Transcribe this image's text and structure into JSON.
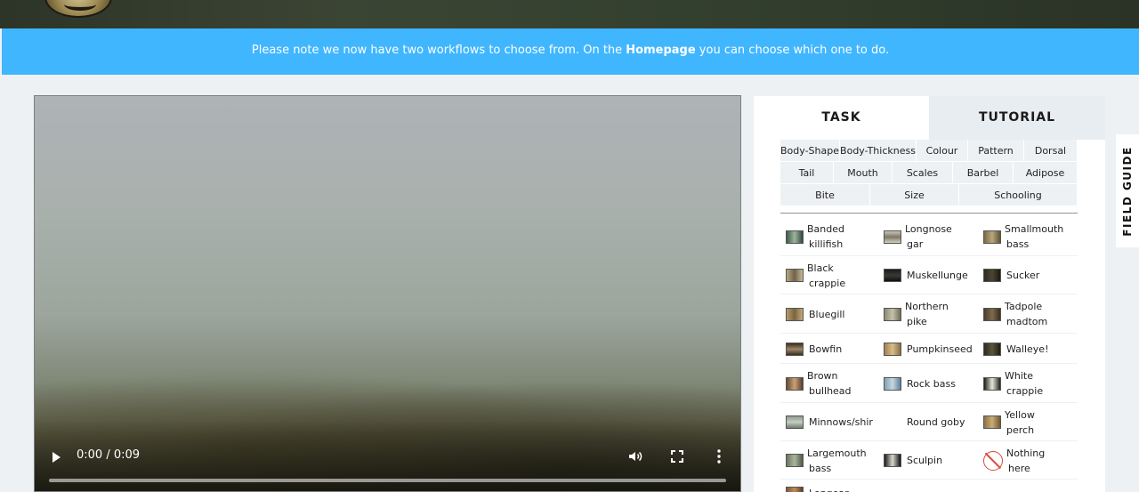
{
  "notice": {
    "prefix": "Please note we now have two workflows to choose from. On the ",
    "link": "Homepage",
    "suffix": " you can choose which one to do."
  },
  "video": {
    "time": "0:00 / 0:09",
    "progress": 0
  },
  "tabs": {
    "task": "TASK",
    "tutorial": "TUTORIAL"
  },
  "filters": [
    [
      "Body-Shape",
      "Body-Thickness",
      "Colour",
      "Pattern",
      "Dorsal"
    ],
    [
      "Tail",
      "Mouth",
      "Scales",
      "Barbel",
      "Adipose"
    ],
    [
      "Bite",
      "Size",
      "Schooling"
    ]
  ],
  "fish": [
    [
      "Banded",
      "killifish"
    ],
    [
      "Longnose",
      "gar"
    ],
    [
      "Smallmouth",
      "bass"
    ],
    [
      "Black",
      "crappie"
    ],
    [
      "Muskellunge"
    ],
    [
      "Sucker"
    ],
    [
      "Bluegill"
    ],
    [
      "Northern",
      "pike"
    ],
    [
      "Tadpole",
      "madtom"
    ],
    [
      "Bowfin"
    ],
    [
      "Pumpkinseed"
    ],
    [
      "Walleye!"
    ],
    [
      "Brown",
      "bullhead"
    ],
    [
      "Rock bass"
    ],
    [
      "White",
      "crappie"
    ],
    [
      "Minnows/shir"
    ],
    [
      "Round goby"
    ],
    [
      "Yellow",
      "perch"
    ],
    [
      "Largemouth",
      "bass"
    ],
    [
      "Sculpin"
    ],
    [
      "Nothing",
      "here"
    ],
    [
      "Longear"
    ]
  ],
  "field_guide": "FIELD GUIDE",
  "colors": {
    "notice_bg": "#40b6ff",
    "tab_inactive_bg": "#e8edf1",
    "chip_bg": "#eef1f4"
  }
}
